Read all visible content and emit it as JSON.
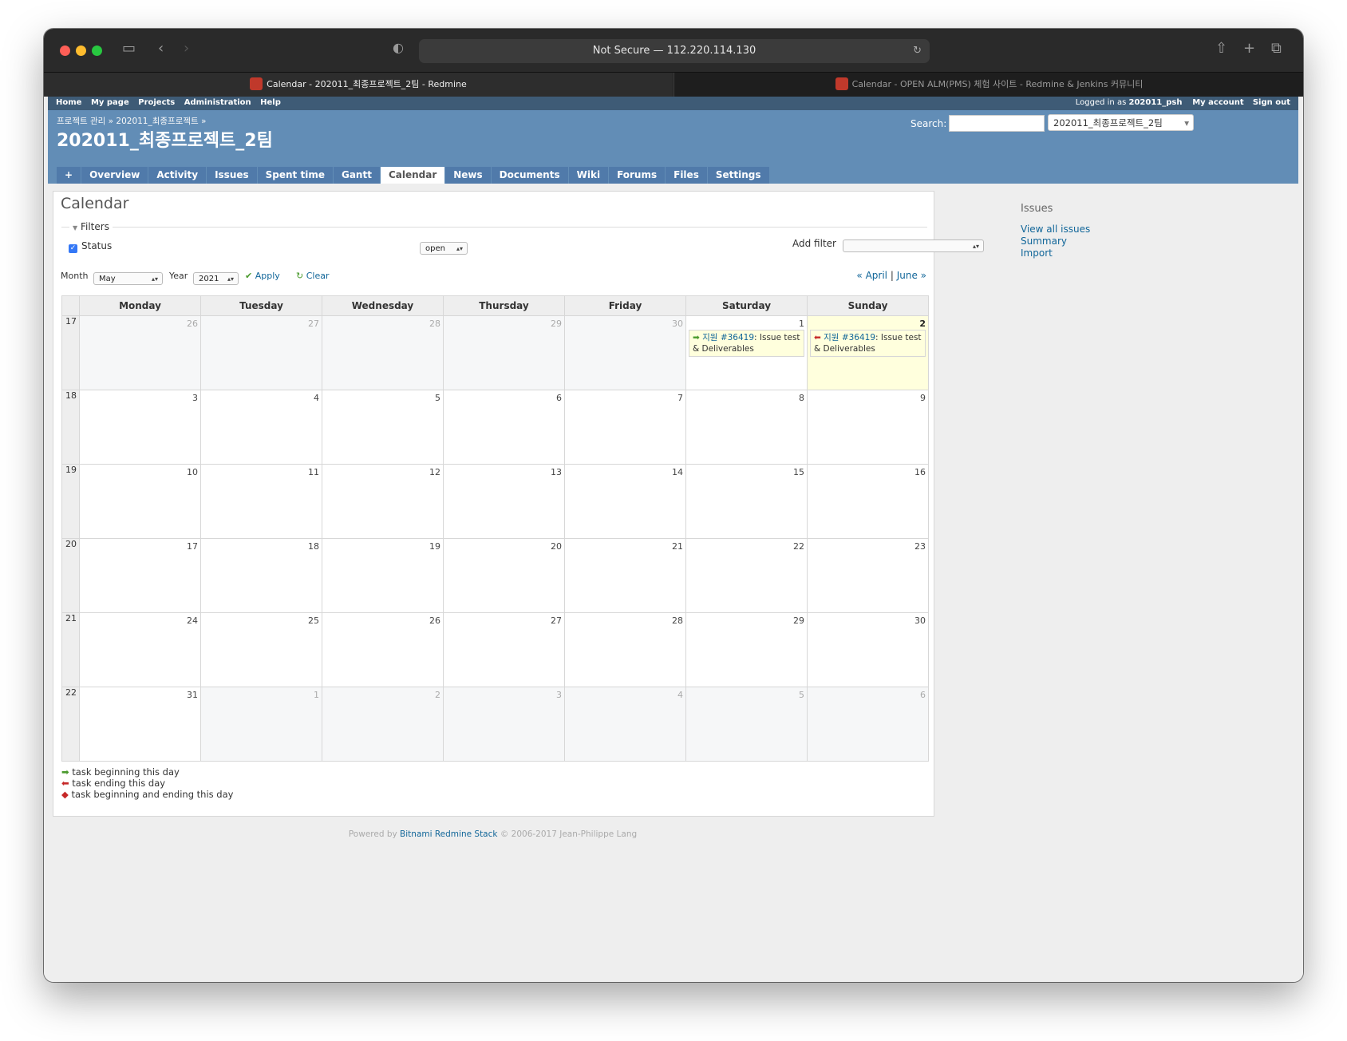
{
  "browser": {
    "url": "Not Secure — 112.220.114.130",
    "tabs": [
      {
        "label": "Calendar - 202011_최종프로젝트_2팀 - Redmine"
      },
      {
        "label": "Calendar - OPEN ALM(PMS) 체험 사이트 - Redmine & Jenkins 커뮤니티"
      }
    ]
  },
  "topmenu": {
    "left": [
      "Home",
      "My page",
      "Projects",
      "Administration",
      "Help"
    ],
    "logged_in_label": "Logged in as",
    "user": "202011_psh",
    "my_account": "My account",
    "sign_out": "Sign out"
  },
  "header": {
    "breadcrumb": "프로젝트 관리 » 202011_최종프로젝트 »",
    "title": "202011_최종프로젝트_2팀",
    "search_label": "Search:",
    "project_jump": "202011_최종프로젝트_2팀"
  },
  "mainmenu": [
    "+",
    "Overview",
    "Activity",
    "Issues",
    "Spent time",
    "Gantt",
    "Calendar",
    "News",
    "Documents",
    "Wiki",
    "Forums",
    "Files",
    "Settings"
  ],
  "content": {
    "heading": "Calendar",
    "filters_legend": "Filters",
    "status_label": "Status",
    "status_value": "open",
    "add_filter_label": "Add filter",
    "month_label": "Month",
    "month_value": "May",
    "year_label": "Year",
    "year_value": "2021",
    "apply": "Apply",
    "clear": "Clear",
    "prev_month": "« April",
    "separator": "|",
    "next_month": "June »"
  },
  "calendar": {
    "days": [
      "Monday",
      "Tuesday",
      "Wednesday",
      "Thursday",
      "Friday",
      "Saturday",
      "Sunday"
    ],
    "weeks": [
      {
        "week": "17",
        "dates": [
          "26",
          "27",
          "28",
          "29",
          "30",
          "1",
          "2"
        ],
        "other": [
          true,
          true,
          true,
          true,
          true,
          false,
          false
        ]
      },
      {
        "week": "18",
        "dates": [
          "3",
          "4",
          "5",
          "6",
          "7",
          "8",
          "9"
        ],
        "other": [
          false,
          false,
          false,
          false,
          false,
          false,
          false
        ]
      },
      {
        "week": "19",
        "dates": [
          "10",
          "11",
          "12",
          "13",
          "14",
          "15",
          "16"
        ],
        "other": [
          false,
          false,
          false,
          false,
          false,
          false,
          false
        ]
      },
      {
        "week": "20",
        "dates": [
          "17",
          "18",
          "19",
          "20",
          "21",
          "22",
          "23"
        ],
        "other": [
          false,
          false,
          false,
          false,
          false,
          false,
          false
        ]
      },
      {
        "week": "21",
        "dates": [
          "24",
          "25",
          "26",
          "27",
          "28",
          "29",
          "30"
        ],
        "other": [
          false,
          false,
          false,
          false,
          false,
          false,
          false
        ]
      },
      {
        "week": "22",
        "dates": [
          "31",
          "1",
          "2",
          "3",
          "4",
          "5",
          "6"
        ],
        "other": [
          false,
          true,
          true,
          true,
          true,
          true,
          true
        ]
      }
    ],
    "today_date": "2",
    "issues": {
      "start": {
        "prefix": "지원",
        "link": "#36419",
        "text": ": Issue test & Deliverables"
      },
      "end": {
        "prefix": "지원",
        "link": "#36419",
        "text": ": Issue test & Deliverables"
      }
    }
  },
  "legend": {
    "begin": "task beginning this day",
    "end": "task ending this day",
    "both": "task beginning and ending this day"
  },
  "footer": {
    "powered": "Powered by",
    "link": "Bitnami Redmine Stack",
    "copy": "© 2006-2017 Jean-Philippe Lang"
  },
  "sidebar": {
    "heading": "Issues",
    "links": [
      "View all issues",
      "Summary",
      "Import"
    ]
  }
}
